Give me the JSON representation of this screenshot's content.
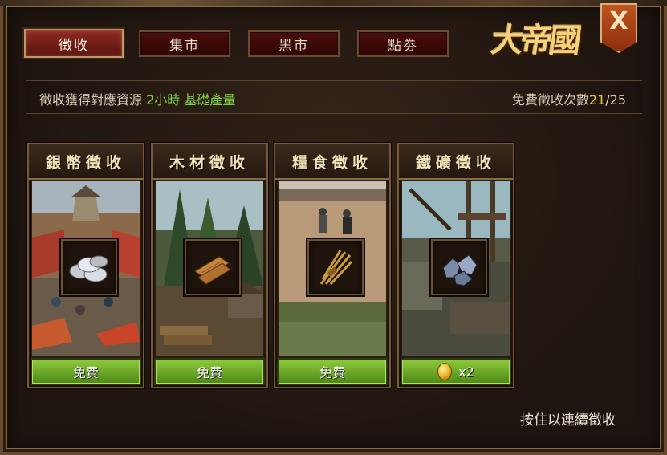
{
  "tabs": [
    {
      "label": "徵收",
      "active": true
    },
    {
      "label": "集市",
      "active": false
    },
    {
      "label": "黑市",
      "active": false
    },
    {
      "label": "點劵",
      "active": false
    }
  ],
  "logo": {
    "text": "大帝國"
  },
  "close": {
    "label": "X"
  },
  "info": {
    "prefix": "徵收獲得對應資源",
    "hours": "2小時",
    "suffix": "基礎產量",
    "free_label": "免費徵收次數",
    "free_used": "21",
    "free_sep": "/25"
  },
  "cards": [
    {
      "title": "銀幣徵收",
      "icon": "silver-coins-icon",
      "button": "免費",
      "coin_cost": false
    },
    {
      "title": "木材徵收",
      "icon": "wood-planks-icon",
      "button": "免費",
      "coin_cost": false
    },
    {
      "title": "糧食徵收",
      "icon": "wheat-bundle-icon",
      "button": "免費",
      "coin_cost": false
    },
    {
      "title": "鐵礦徵收",
      "icon": "iron-ore-icon",
      "button": "x2",
      "coin_cost": true
    }
  ],
  "hint": "按住以連續徵收",
  "colors": {
    "accent_green": "#7fd64a",
    "accent_yellow": "#f0c84a",
    "active_tab": "#8c2a22",
    "button_green": "#6ca82a"
  }
}
